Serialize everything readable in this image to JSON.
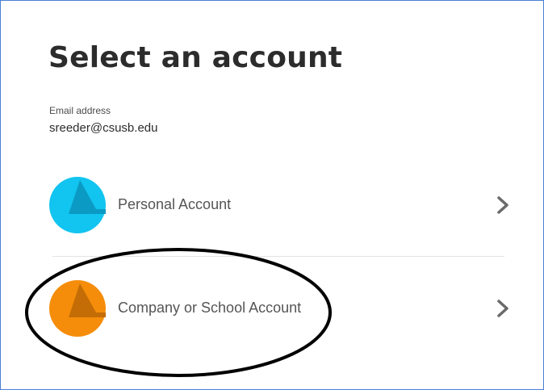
{
  "page": {
    "title": "Select an account"
  },
  "email": {
    "label": "Email address",
    "value": "sreeder@csusb.edu"
  },
  "accounts": [
    {
      "label": "Personal Account",
      "color": "#12c4f0",
      "fold_color": "#0b9ac4",
      "icon": "personal-account-avatar-icon"
    },
    {
      "label": "Company or School Account",
      "color": "#f58d0a",
      "fold_color": "#c46d06",
      "icon": "company-account-avatar-icon"
    }
  ],
  "colors": {
    "title": "#2c2c2c",
    "frame_border": "#4a7fd4",
    "annotation": "#000000"
  }
}
